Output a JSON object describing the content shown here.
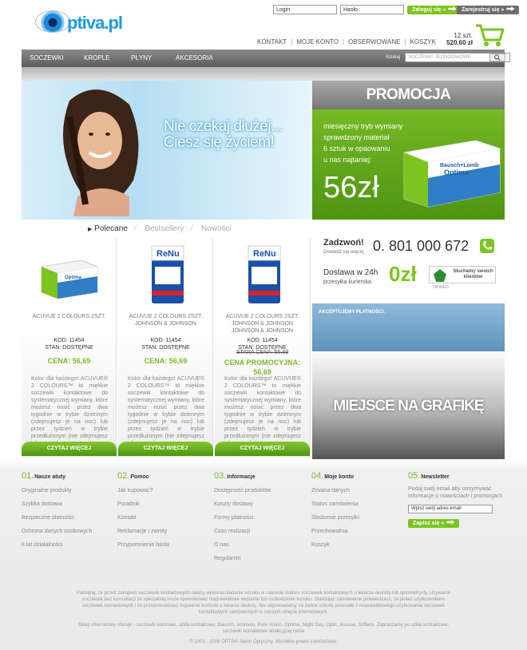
{
  "header": {
    "logo_text": "ptiva.pl",
    "login_placeholder": "Login",
    "password_placeholder": "Hasło",
    "login_button": "Zaloguj się »",
    "register_button": "Zarejestruj się »",
    "top_links": [
      "KONTAKT",
      "MOJE KONTO",
      "OBSERWOWANE",
      "KOSZYK"
    ],
    "cart_count": "12 szt.",
    "cart_total": "520.60 zł"
  },
  "nav": {
    "items": [
      "SOCZEWKI",
      "KROPLE",
      "PŁYNY",
      "AKCESORIA"
    ],
    "search_label": "Szukaj",
    "search_placeholder": "SOCZEWKI JEDNODNIOWE"
  },
  "hero": {
    "line1": "Nie czekaj dłużej...",
    "line2": "Ciesz się życiem!"
  },
  "promo": {
    "title": "PROMOCJA",
    "lines": [
      "miesięczny tryb wymiany",
      "sprawdzony materiał",
      "6 sztuk w opaowaniu",
      "u nas najtaniej:"
    ],
    "price": "56zł",
    "box_brand": "Bausch+Lomb",
    "box_name": "Optima"
  },
  "tabs": [
    "Polecane",
    "Bestsellery",
    "Nowości"
  ],
  "products": [
    {
      "box": "Optima",
      "name1": "ACUVUE 2 COLOURS 2SZT.",
      "name2": "",
      "name3": "",
      "kod": "KOD: 11454",
      "stan": "STAN: DOSTĘPNE",
      "old": "",
      "price": "CENA: 56,69",
      "price2": "",
      "desc": "Kolor dla każdego! ACUVUE® 2 COLOURS™ to miękkie soczewki kontaktowe do systematycznej wymiany, które możesz nosić przez dwa tygodnie w trybie dziennym (zdejmujesz je na noc) lub przez tydzień w trybie przedłużonym (nie zdejmujesz ich na noc).",
      "button": "CZYTAJ WIĘCEJ"
    },
    {
      "box": "ReNu",
      "name1": "ACUVUE 2 COLOURS 2SZT.",
      "name2": "JOHNSON & JOHNSON",
      "name3": "",
      "kod": "KOD: 11454",
      "stan": "STAN: DOSTĘPNE",
      "old": "",
      "price": "CENA: 56,69",
      "price2": "",
      "desc": "Kolor dla każdego! ACUVUE® 2 COLOURS™ to miękkie soczewki kontaktowe do systematycznej wymiany, które możesz nosić przez dwa tygodnie w trybie dziennym (zdejmujesz je na noc) lub przez tydzień w trybie przedłużonym (nie zdejmujesz ich na noc).",
      "button": "CZYTAJ WIĘCEJ"
    },
    {
      "box": "ReNu",
      "name1": "ACUVUE 2 COLOURS 2SZT.",
      "name2": "JOHNSON & JOHNSON",
      "name3": "JOHNSON & JOHNSON",
      "kod": "KOD: 11454",
      "stan": "STAN: DOSTĘPNE",
      "old": "STARA CENA: 56,69",
      "price": "CENA PROMOCYJNA:",
      "price2": "56,69",
      "desc": "Kolor dla każdego! ACUVUE® 2 COLOURS™ to miękkie soczewki kontaktowe do systematycznej wymiany, które możesz nosić przez dwa tygodnie w trybie dziennym (zdejmujesz je na noc) lub przez tydzień w trybie przedłużonym (nie zdejmujesz ich na noc).",
      "button": "CZYTAJ WIĘCEJ"
    }
  ],
  "contact": {
    "call": "Zadzwoń!",
    "call_sub": "Dowiedz się więcej",
    "phone": "0. 801 000 672",
    "delivery": "Dostawa w 24h",
    "delivery_sub": "przesyłka kurierska",
    "zero_price": "0zł",
    "badge_text": "Słuchamy swoich klientów",
    "badge_logo": "OPINEO"
  },
  "payments_label": "AKCEPTUJEMY PŁATNOŚCI:",
  "graphic_label": "MIEJSCE NA GRAFIKĘ",
  "footer": {
    "columns": [
      {
        "num": "01.",
        "title": "Nasze atuty",
        "items": [
          "Oryginalne produkty",
          "Szybka dostawa",
          "Bezpieczne płatności",
          "Ochrona danych osobowych",
          "8 lat działalności"
        ]
      },
      {
        "num": "02.",
        "title": "Pomoc",
        "items": [
          "Jak kupować?",
          "Poradnik",
          "Kontakt",
          "Reklamacje i zwroty",
          "Przypomnienie hasła"
        ]
      },
      {
        "num": "03.",
        "title": "Informacje",
        "items": [
          "Dostępność produktów",
          "Koszty dostawy",
          "Formy płatności",
          "Czas realizacji",
          "O nas",
          "Regulamin"
        ]
      },
      {
        "num": "04.",
        "title": "Moje konto",
        "items": [
          "Zmiana danych",
          "Status zamówienia",
          "Śledzenie przesyłki",
          "Przechowalnia",
          "Koszyk"
        ]
      }
    ],
    "newsletter": {
      "num": "05.",
      "title": "Newsletter",
      "text": "Podaj swój email aby otrzymywać informacje o nowościach i promocjach",
      "placeholder": "Wpisz swój adres email",
      "button": "Zapisz się »"
    },
    "disclaimer": "Pamiętaj, że przed zakupem soczewek kontaktowych należy wykonać badanie wzroku w zakresie doboru soczewek kontaktowych u lekarza okulisty lub optometrysty. Używanie soczewek bez konsultacji ze specjalistą może spowodować nieprawidłowe widzenie lub uszkodzenie wzroku. Składając zamówienie potwierdzasz, że jesteś użytkownikiem soczewek kontaktowych i że przeprowadzasz regularne kontrole u lekarza okulisty. Nie odpowiadamy za żadne szkody powstałe z nieprawidłowego użytkowania soczewek kontaktowych zamówionych w naszym sklepie internetowym.",
    "shopline": "Sklep internetowy oferuje - soczewki kolorowe, szkła kontaktowe, Bausch, Johnson, Pure Vision, Optima, Night Day, Optic, Acuvue, Soflens. Zapraszamy po szkła kontaktowe, soczewki kontaktowe atrakcyjnej cenie",
    "copyright": "© 2002 - 2009 OPTIVA Salon Optyczny. Wszelkie prawa zastrzeżone."
  }
}
